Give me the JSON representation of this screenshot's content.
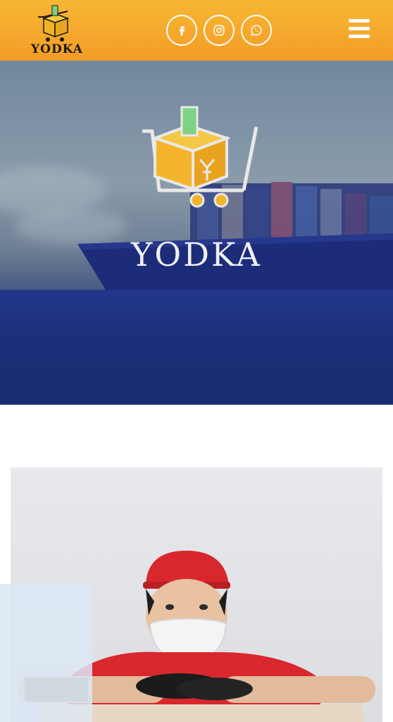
{
  "header": {
    "logo_text": "YODKA",
    "social": [
      {
        "icon": "facebook-icon"
      },
      {
        "icon": "instagram-icon"
      },
      {
        "icon": "whatsapp-icon"
      }
    ],
    "menu_icon": "hamburger-menu-icon"
  },
  "hero": {
    "logo_text": "YODKA"
  },
  "colors": {
    "header_gradient_top": "#f7b733",
    "header_gradient_bottom": "#f39c26",
    "hero_overlay": "#1a2c6b",
    "logo_yellow": "#f3b42c",
    "white": "#ffffff"
  }
}
